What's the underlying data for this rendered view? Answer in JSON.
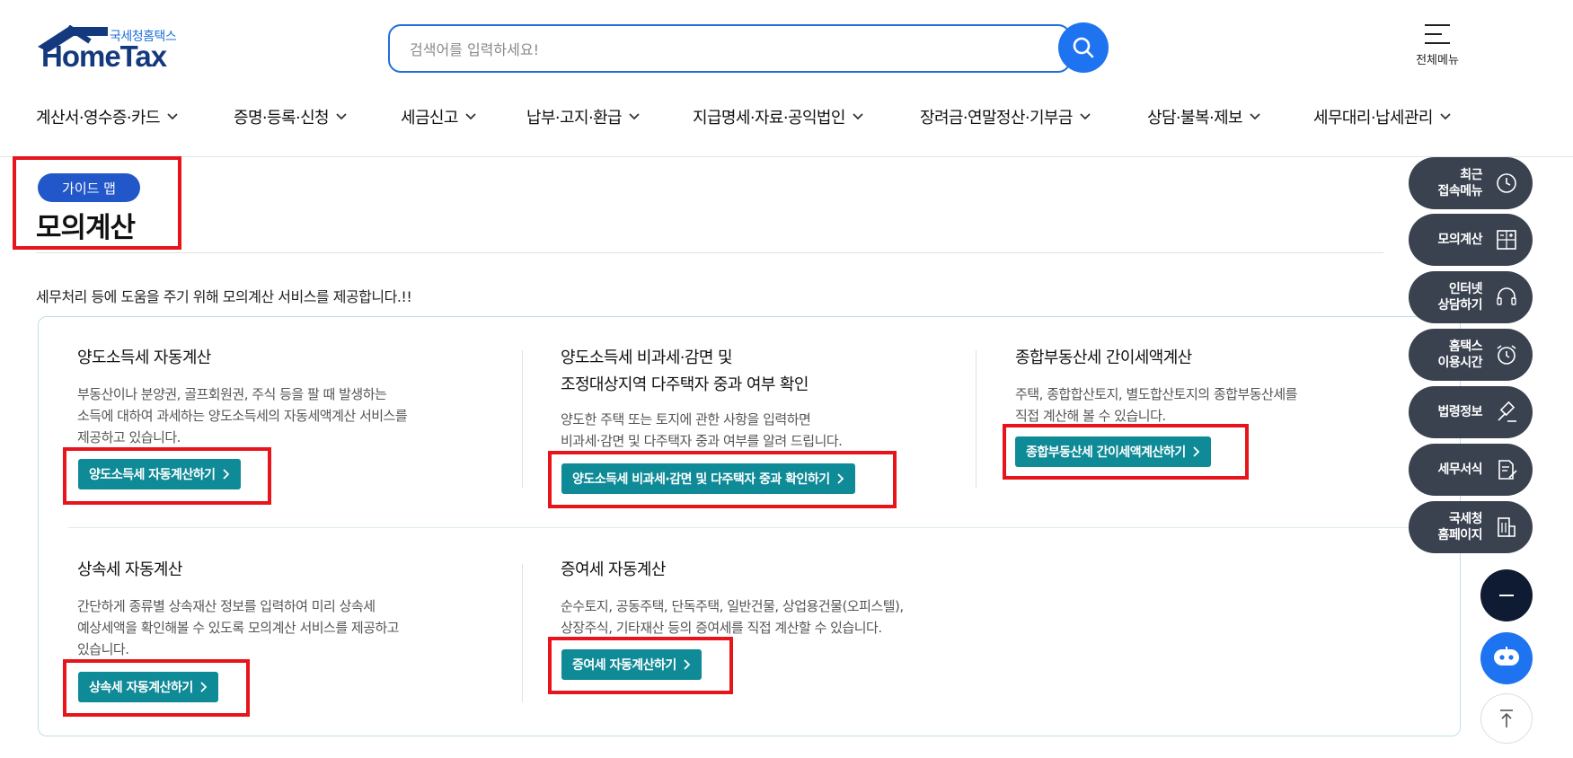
{
  "header": {
    "logo_sub": "국세청홈택스",
    "logo_text": "HomeTax",
    "search_placeholder": "검색어를 입력하세요!",
    "allmenu_label": "전체메뉴"
  },
  "gnb": [
    {
      "label": "계산서·영수증·카드"
    },
    {
      "label": "증명·등록·신청"
    },
    {
      "label": "세금신고"
    },
    {
      "label": "납부·고지·환급"
    },
    {
      "label": "지급명세·자료·공익법인"
    },
    {
      "label": "장려금·연말정산·기부금"
    },
    {
      "label": "상담·불복·제보"
    },
    {
      "label": "세무대리·납세관리"
    }
  ],
  "page": {
    "badge": "가이드 맵",
    "title": "모의계산",
    "description": "세무처리 등에 도움을 주기 위해 모의계산 서비스를 제공합니다.!!"
  },
  "cards": [
    {
      "title_lines": [
        "양도소득세 자동계산"
      ],
      "desc_lines": [
        "부동산이나 분양권, 골프회원권, 주식 등을 팔 때 발생하는",
        "소득에 대하여 과세하는 양도소득세의 자동세액계산 서비스를",
        "제공하고 있습니다."
      ],
      "button": "양도소득세 자동계산하기"
    },
    {
      "title_lines": [
        "양도소득세 비과세·감면 및",
        "조정대상지역 다주택자 중과 여부 확인"
      ],
      "desc_lines": [
        "양도한 주택 또는 토지에 관한 사항을 입력하면",
        "비과세·감면 및 다주택자 중과 여부를 알려 드립니다."
      ],
      "button": "양도소득세 비과세·감면 및 다주택자 중과 확인하기"
    },
    {
      "title_lines": [
        "종합부동산세 간이세액계산"
      ],
      "desc_lines": [
        "주택, 종합합산토지, 별도합산토지의 종합부동산세를",
        "직접 계산해 볼 수 있습니다."
      ],
      "button": "종합부동산세 간이세액계산하기"
    },
    {
      "title_lines": [
        "상속세 자동계산"
      ],
      "desc_lines": [
        "간단하게 종류별 상속재산 정보를 입력하여 미리 상속세",
        "예상세액을 확인해볼 수 있도록 모의계산 서비스를 제공하고",
        "있습니다."
      ],
      "button": "상속세 자동계산하기"
    },
    {
      "title_lines": [
        "증여세 자동계산"
      ],
      "desc_lines": [
        "순수토지, 공동주택, 단독주택, 일반건물, 상업용건물(오피스텔),",
        "상장주식, 기타재산 등의 증여세를 직접 계산할 수 있습니다."
      ],
      "button": "증여세 자동계산하기"
    }
  ],
  "quick_menu": [
    {
      "label": "최근\n접속메뉴",
      "icon": "clock-icon"
    },
    {
      "label": "모의계산",
      "icon": "calculator-icon"
    },
    {
      "label": "인터넷\n상담하기",
      "icon": "headset-icon"
    },
    {
      "label": "홈택스\n이용시간",
      "icon": "alarm-clock-icon"
    },
    {
      "label": "법령정보",
      "icon": "gavel-icon"
    },
    {
      "label": "세무서식",
      "icon": "document-edit-icon"
    },
    {
      "label": "국세청\n홈페이지",
      "icon": "building-icon"
    }
  ],
  "colors": {
    "brand_blue": "#1e74f0",
    "badge_blue": "#2157c9",
    "button_teal": "#0f8a97",
    "quick_dark": "#3a4250",
    "highlight_red": "#e8141c"
  }
}
